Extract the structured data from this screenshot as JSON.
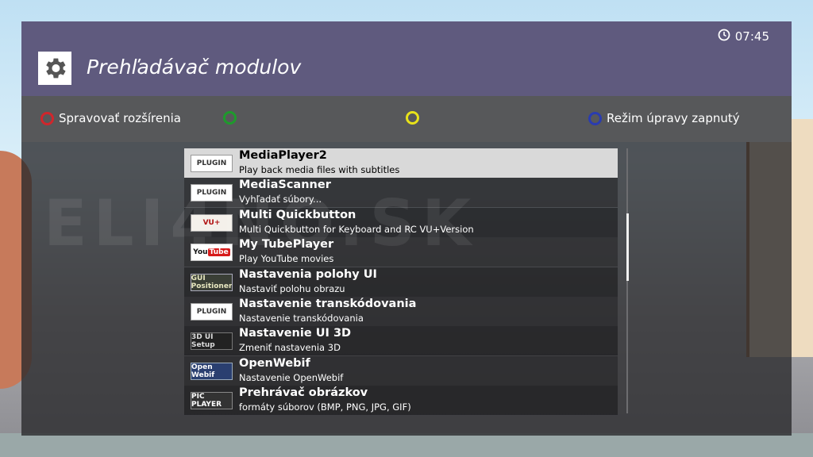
{
  "header": {
    "title": "Prehľadávač modulov",
    "clock": "07:45",
    "settings_icon": "gear-icon",
    "clock_icon": "clock-icon"
  },
  "keys": {
    "red": {
      "label": "Spravovať rozšírenia",
      "color": "#d0262c"
    },
    "green": {
      "label": "",
      "color": "#1e9a2c"
    },
    "yellow": {
      "label": "",
      "color": "#e8e21a"
    },
    "blue": {
      "label": "Režim úpravy zapnutý",
      "color": "#2a3cb0"
    }
  },
  "plugins": [
    {
      "name": "MediaPlayer2",
      "desc": "Play back media files with subtitles",
      "thumb": "PLUGIN"
    },
    {
      "name": "MediaScanner",
      "desc": "Vyhľadať súbory...",
      "thumb": "PLUGIN"
    },
    {
      "name": "Multi Quickbutton",
      "desc": "Multi Quickbutton for Keyboard and RC VU+Version",
      "thumb": "VU+"
    },
    {
      "name": "My TubePlayer",
      "desc": "Play YouTube movies",
      "thumb": "YouTube"
    },
    {
      "name": "Nastavenia polohy UI",
      "desc": "Nastaviť polohu obrazu",
      "thumb": "GUI Positioner"
    },
    {
      "name": "Nastavenie transkódovania",
      "desc": "Nastavenie transkódovania",
      "thumb": "PLUGIN"
    },
    {
      "name": "Nastavenie UI 3D",
      "desc": "Zmeniť nastavenia 3D",
      "thumb": "3D UI Setup"
    },
    {
      "name": "OpenWebif",
      "desc": "Nastavenie OpenWebif",
      "thumb": "Open Webif"
    },
    {
      "name": "Prehrávač obrázkov",
      "desc": "formáty súborov (BMP, PNG, JPG, GIF)",
      "thumb": "PIC PLAYER"
    }
  ],
  "watermark": "ELI4NO.SK"
}
